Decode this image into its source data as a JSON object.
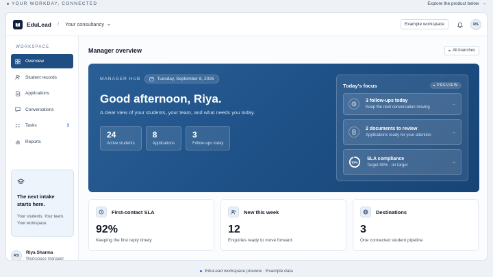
{
  "top_strip": {
    "left_text": "YOUR WORKDAY, CONNECTED",
    "right_text": "Explore the product below",
    "right_arrow": "→"
  },
  "app": {
    "brand": "EduLead",
    "separator": "/",
    "consultancy": "Your consultancy",
    "example_workspace": "Example workspace",
    "user_initials": "RS"
  },
  "sidebar": {
    "section_label": "WORKSPACE",
    "items": [
      {
        "label": "Overview",
        "icon": "grid-icon",
        "active": true
      },
      {
        "label": "Student records",
        "icon": "users-icon"
      },
      {
        "label": "Applications",
        "icon": "document-icon"
      },
      {
        "label": "Conversations",
        "icon": "chat-icon"
      },
      {
        "label": "Tasks",
        "icon": "tasks-icon",
        "badge": "3"
      },
      {
        "label": "Reports",
        "icon": "chart-icon"
      }
    ],
    "promo": {
      "title": "The next intake starts here.",
      "body": "Your students. Your team. Your workspace."
    },
    "user": {
      "initials": "RS",
      "name": "Riya Sharma",
      "role": "Workspace manager"
    }
  },
  "main": {
    "title": "Manager overview",
    "branches": "All branches",
    "hero": {
      "hub_label": "MANAGER HUB",
      "date": "Tuesday, September 8, 2026",
      "greeting": "Good afternoon, Riya.",
      "subtitle": "A clear view of your students, your team, and what needs you today.",
      "stats": [
        {
          "value": "24",
          "label": "Active students"
        },
        {
          "value": "8",
          "label": "Applications"
        },
        {
          "value": "3",
          "label": "Follow-ups today"
        }
      ],
      "focus": {
        "title": "Today's focus",
        "badge": "PREVIEW",
        "items": [
          {
            "title": "3 follow-ups today",
            "desc": "Keep the next conversation moving"
          },
          {
            "title": "2 documents to review",
            "desc": "Applications ready for your attention"
          },
          {
            "title": "SLA compliance",
            "desc": "Target 90% · on target",
            "ring_label": "92%",
            "ring_value": 0.92
          }
        ]
      }
    },
    "cards": [
      {
        "title": "First-contact SLA",
        "value": "92%",
        "desc": "Keeping the first reply timely",
        "icon": "clock-icon"
      },
      {
        "title": "New this week",
        "value": "12",
        "desc": "Enquiries ready to move forward",
        "icon": "users-icon"
      },
      {
        "title": "Destinations",
        "value": "3",
        "desc": "One connected student pipeline",
        "icon": "globe-icon"
      }
    ]
  },
  "footer": {
    "text": "EduLead workspace preview · Example data"
  },
  "colors": {
    "accent": "#1f4f82",
    "hero": "#1f5288",
    "badge": "#2563eb"
  }
}
